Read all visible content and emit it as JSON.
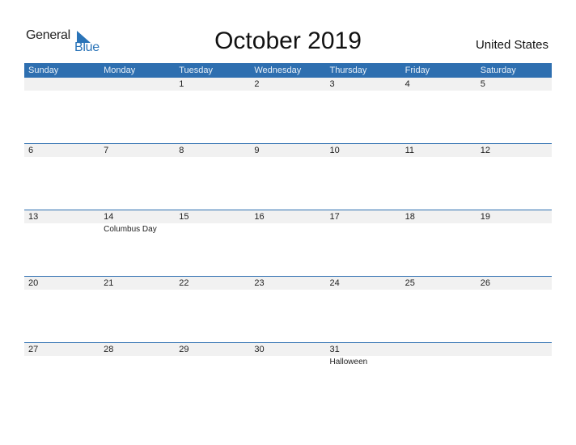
{
  "brand": {
    "word1": "General",
    "word2": "Blue",
    "color": "#2a74b8"
  },
  "title": "October 2019",
  "country": "United States",
  "header_color": "#2e6fb0",
  "weekdays": [
    "Sunday",
    "Monday",
    "Tuesday",
    "Wednesday",
    "Thursday",
    "Friday",
    "Saturday"
  ],
  "weeks": [
    {
      "days": [
        "",
        "",
        "1",
        "2",
        "3",
        "4",
        "5"
      ],
      "events": [
        "",
        "",
        "",
        "",
        "",
        "",
        ""
      ]
    },
    {
      "days": [
        "6",
        "7",
        "8",
        "9",
        "10",
        "11",
        "12"
      ],
      "events": [
        "",
        "",
        "",
        "",
        "",
        "",
        ""
      ]
    },
    {
      "days": [
        "13",
        "14",
        "15",
        "16",
        "17",
        "18",
        "19"
      ],
      "events": [
        "",
        "Columbus Day",
        "",
        "",
        "",
        "",
        ""
      ]
    },
    {
      "days": [
        "20",
        "21",
        "22",
        "23",
        "24",
        "25",
        "26"
      ],
      "events": [
        "",
        "",
        "",
        "",
        "",
        "",
        ""
      ]
    },
    {
      "days": [
        "27",
        "28",
        "29",
        "30",
        "31",
        "",
        ""
      ],
      "events": [
        "",
        "",
        "",
        "",
        "Halloween",
        "",
        ""
      ]
    }
  ]
}
